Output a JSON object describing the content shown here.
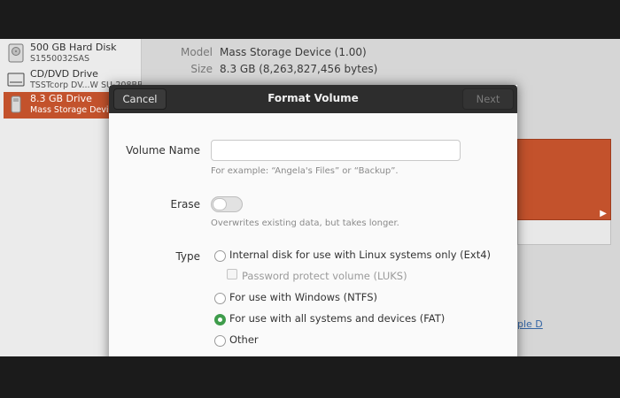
{
  "sidebar": {
    "drives": [
      {
        "name": "500 GB Hard Disk",
        "sub": "S1550032SAS",
        "icon": "hard-disk-icon"
      },
      {
        "name": "CD/DVD Drive",
        "sub": "TSSTcorp DV...W SU-208BB",
        "icon": "optical-drive-icon"
      },
      {
        "name": "8.3 GB Drive",
        "sub": "Mass Storage Device",
        "icon": "usb-drive-icon"
      }
    ]
  },
  "details": {
    "model_label": "Model",
    "model_value": "Mass Storage Device (1.00)",
    "size_label": "Size",
    "size_value": "8.3 GB (8,263,827,456 bytes)",
    "link_text": "ple D"
  },
  "dialog": {
    "title": "Format Volume",
    "cancel_label": "Cancel",
    "next_label": "Next",
    "volume_name_label": "Volume Name",
    "volume_name_value": "",
    "volume_name_hint": "For example: “Angela's Files” or “Backup”.",
    "erase_label": "Erase",
    "erase_on": false,
    "erase_hint": "Overwrites existing data, but takes longer.",
    "type_label": "Type",
    "type_options": [
      {
        "label": "Internal disk for use with Linux systems only (Ext4)",
        "selected": false
      },
      {
        "label": "Password protect volume (LUKS)",
        "selected": false
      },
      {
        "label": "For use with Windows (NTFS)",
        "selected": false
      },
      {
        "label": "For use with all systems and devices (FAT)",
        "selected": true
      },
      {
        "label": "Other",
        "selected": false
      }
    ]
  },
  "colors": {
    "accent": "#c3522c",
    "radio_selected": "#3e9c4b",
    "header_bar": "#2d2d2d"
  }
}
